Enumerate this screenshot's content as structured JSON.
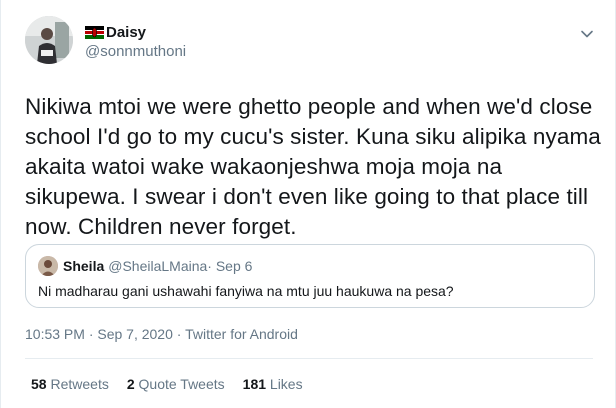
{
  "tweet": {
    "display_name": "Daisy",
    "handle": "@sonnmuthoni",
    "text": "Nikiwa mtoi we were ghetto people and when we'd close school I'd go to my cucu's sister. Kuna siku alipika nyama akaita watoi wake wakaonjeshwa moja moja na sikupewa. I swear i don't even like going to that place till now. Children never forget.",
    "timestamp": "10:53 PM · Sep 7, 2020",
    "separator": " · ",
    "source": "Twitter for Android"
  },
  "quoted_tweet": {
    "display_name": "Sheila",
    "handle": "@SheilaLMaina",
    "date": " · Sep 6",
    "text": "Ni madharau gani ushawahi fanyiwa na mtu juu haukuwa na pesa?"
  },
  "stats": {
    "retweets_count": "58",
    "retweets_label": "Retweets",
    "quote_count": "2",
    "quote_label": "Quote Tweets",
    "likes_count": "181",
    "likes_label": "Likes"
  },
  "icons": {
    "flag": "kenya-flag-icon",
    "menu": "chevron-down-icon"
  },
  "colors": {
    "primary_text": "#14171a",
    "secondary_text": "#657786",
    "border": "#ccd6dd"
  }
}
